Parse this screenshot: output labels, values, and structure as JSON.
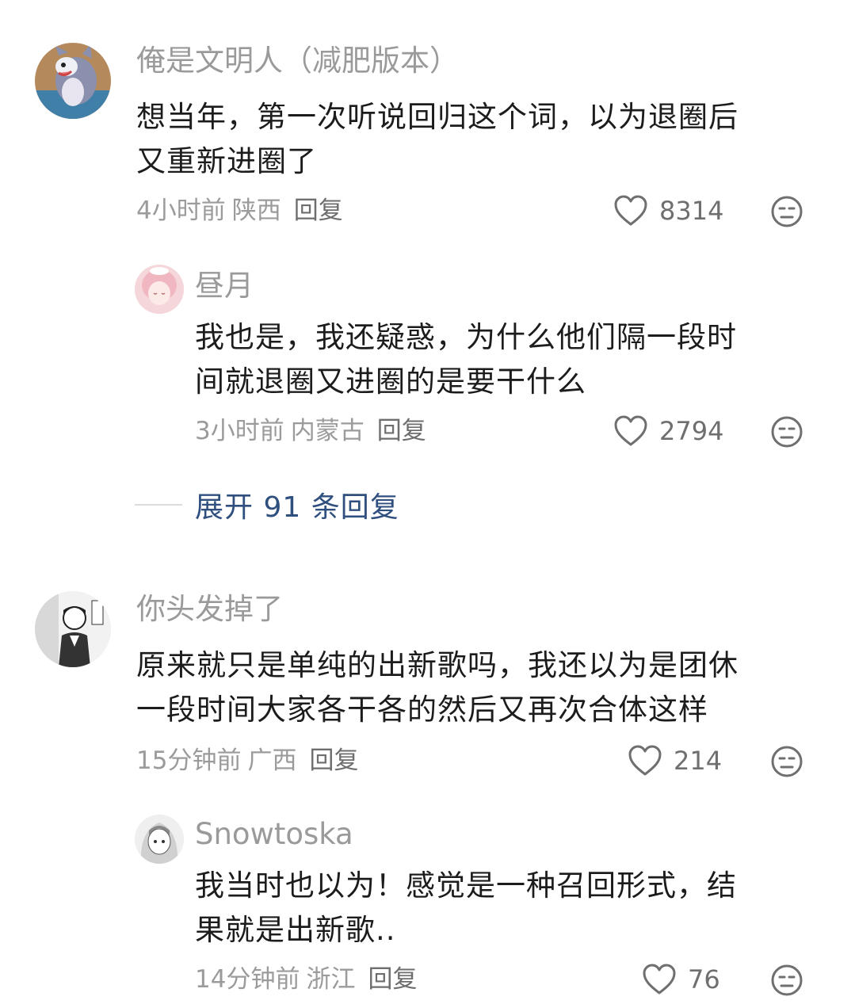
{
  "comments": [
    {
      "username": "俺是文明人（减肥版本）",
      "content_lines": [
        "想当年，第一次听说回归这个词，以为退圈后",
        "又重新进圈了"
      ],
      "time": "4小时前",
      "location": "陕西",
      "reply_label": "回复",
      "likes": "8314",
      "avatar_icon": "cartoon-cat-avatar",
      "replies": [
        {
          "username": "昼月",
          "content_lines": [
            "我也是，我还疑惑，为什么他们隔一段时",
            "间就退圈又进圈的是要干什么"
          ],
          "time": "3小时前",
          "location": "内蒙古",
          "reply_label": "回复",
          "likes": "2794",
          "avatar_icon": "anime-girl-pink-avatar"
        }
      ],
      "expand_label": "展开 91 条回复"
    },
    {
      "username": "你头发掉了",
      "content_lines": [
        "原来就只是单纯的出新歌吗，我还以为是团休",
        "一段时间大家各干各的然后又再次合体这样"
      ],
      "time": "15分钟前",
      "location": "广西",
      "reply_label": "回复",
      "likes": "214",
      "avatar_icon": "manga-boy-avatar",
      "replies": [
        {
          "username": "Snowtoska",
          "content_lines": [
            "我当时也以为！感觉是一种召回形式，结",
            "果就是出新歌.."
          ],
          "time": "14分钟前",
          "location": "浙江",
          "reply_label": "回复",
          "likes": "76",
          "avatar_icon": "manga-girl-avatar"
        }
      ]
    }
  ],
  "colors": {
    "username": "#9a9a9a",
    "content": "#1c1c1c",
    "meta": "#9b9b9b",
    "expand_link": "#2f4f7f",
    "background": "#ffffff"
  }
}
